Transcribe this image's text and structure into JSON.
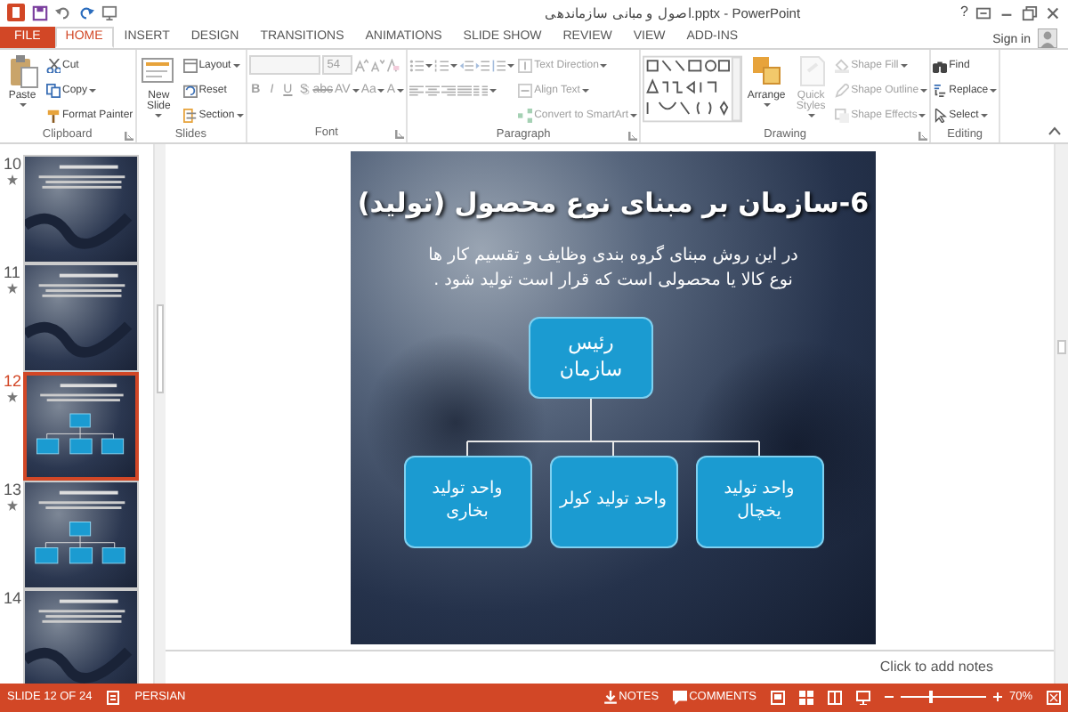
{
  "window": {
    "title": "اصول و مبانی سازماندهی.pptx - PowerPoint",
    "help": "?"
  },
  "tabs": [
    {
      "label": "FILE",
      "kind": "file",
      "selected": false
    },
    {
      "label": "HOME",
      "kind": "tab",
      "selected": true
    },
    {
      "label": "INSERT",
      "kind": "tab",
      "selected": false
    },
    {
      "label": "DESIGN",
      "kind": "tab",
      "selected": false
    },
    {
      "label": "TRANSITIONS",
      "kind": "tab",
      "selected": false
    },
    {
      "label": "ANIMATIONS",
      "kind": "tab",
      "selected": false
    },
    {
      "label": "SLIDE SHOW",
      "kind": "tab",
      "selected": false
    },
    {
      "label": "REVIEW",
      "kind": "tab",
      "selected": false
    },
    {
      "label": "VIEW",
      "kind": "tab",
      "selected": false
    },
    {
      "label": "ADD-INS",
      "kind": "tab",
      "selected": false
    }
  ],
  "account": {
    "label": "Sign in"
  },
  "ribbon": {
    "groups": [
      {
        "label": "Clipboard",
        "launcher": true,
        "columns": [
          [
            [
              {
                "kind": "large",
                "label": "Paste",
                "caret": true,
                "disabled": false
              }
            ]
          ],
          [
            [
              {
                "kind": "small",
                "label": "Cut",
                "caret": false,
                "disabled": false
              }
            ],
            [
              {
                "kind": "small",
                "label": "Copy",
                "caret": true,
                "disabled": false
              }
            ],
            [
              {
                "kind": "small",
                "label": "Format Painter",
                "caret": false,
                "disabled": false
              }
            ]
          ]
        ]
      },
      {
        "label": "Slides",
        "launcher": false,
        "columns": [
          [
            [
              {
                "kind": "large",
                "label": "New Slide",
                "caret": true,
                "disabled": false
              }
            ]
          ],
          [
            [
              {
                "kind": "small",
                "label": "Layout",
                "caret": true,
                "disabled": false
              }
            ],
            [
              {
                "kind": "small",
                "label": "Reset",
                "caret": false,
                "disabled": false
              }
            ],
            [
              {
                "kind": "small",
                "label": "Section",
                "caret": true,
                "disabled": false
              }
            ]
          ]
        ]
      },
      {
        "label": "Font",
        "launcher": true,
        "columns": [
          [
            [
              {
                "kind": "fontname",
                "disabled": true
              },
              {
                "kind": "fontsize",
                "value": "54",
                "disabled": true
              },
              {
                "kind": "icon",
                "caret": false,
                "disabled": true
              },
              {
                "kind": "icon",
                "caret": false,
                "disabled": true
              },
              {
                "kind": "icon",
                "caret": false,
                "disabled": true
              }
            ],
            [
              {
                "kind": "bold",
                "label": "B",
                "caret": false,
                "disabled": true
              },
              {
                "kind": "italic",
                "label": "I",
                "caret": false,
                "disabled": true
              },
              {
                "kind": "underline",
                "label": "U",
                "caret": false,
                "disabled": true
              },
              {
                "kind": "shadow",
                "label": "S",
                "caret": false,
                "disabled": true
              },
              {
                "kind": "strike",
                "label": "abc",
                "caret": false,
                "disabled": true
              },
              {
                "kind": "format",
                "label": "AV",
                "caret": true,
                "disabled": true
              },
              {
                "kind": "format",
                "label": "Aa",
                "caret": true,
                "disabled": true
              },
              {
                "kind": "format",
                "label": "A",
                "caret": true,
                "disabled": true
              }
            ]
          ]
        ]
      },
      {
        "label": "Paragraph",
        "launcher": true,
        "columns": [
          [
            [
              {
                "kind": "icon",
                "caret": true,
                "disabled": true
              },
              {
                "kind": "icon",
                "caret": true,
                "disabled": true
              },
              {
                "kind": "icon",
                "caret": false,
                "disabled": true
              },
              {
                "kind": "icon",
                "caret": false,
                "disabled": true
              },
              {
                "kind": "icon",
                "caret": true,
                "disabled": true
              }
            ],
            [
              {
                "kind": "icon",
                "caret": false,
                "disabled": true
              },
              {
                "kind": "icon",
                "caret": false,
                "disabled": true
              },
              {
                "kind": "icon",
                "caret": false,
                "disabled": true
              },
              {
                "kind": "icon",
                "caret": false,
                "disabled": true
              },
              {
                "kind": "icon",
                "caret": true,
                "disabled": true
              }
            ]
          ],
          [
            [
              {
                "kind": "small",
                "label": "Text Direction",
                "caret": true,
                "disabled": true
              }
            ],
            [
              {
                "kind": "small",
                "label": "Align Text",
                "caret": true,
                "disabled": true
              }
            ],
            [
              {
                "kind": "small",
                "label": "Convert to SmartArt",
                "caret": true,
                "disabled": true
              }
            ]
          ]
        ]
      },
      {
        "label": "Drawing",
        "launcher": true,
        "columns": [
          [
            [
              {
                "kind": "gallery",
                "disabled": false
              }
            ]
          ],
          [
            [
              {
                "kind": "large",
                "label": "Arrange",
                "caret": true,
                "disabled": false
              }
            ]
          ],
          [
            [
              {
                "kind": "large",
                "label": "Quick Styles",
                "caret": true,
                "disabled": true
              }
            ]
          ],
          [
            [
              {
                "kind": "small",
                "label": "Shape Fill",
                "caret": true,
                "disabled": true
              }
            ],
            [
              {
                "kind": "small",
                "label": "Shape Outline",
                "caret": true,
                "disabled": true
              }
            ],
            [
              {
                "kind": "small",
                "label": "Shape Effects",
                "caret": true,
                "disabled": true
              }
            ]
          ]
        ]
      },
      {
        "label": "Editing",
        "launcher": false,
        "columns": [
          [
            [
              {
                "kind": "small",
                "label": "Find",
                "caret": false,
                "disabled": false
              }
            ],
            [
              {
                "kind": "small",
                "label": "Replace",
                "caret": true,
                "disabled": false
              }
            ],
            [
              {
                "kind": "small",
                "label": "Select",
                "caret": true,
                "disabled": false
              }
            ]
          ]
        ]
      }
    ]
  },
  "thumbnails": [
    {
      "number": "10",
      "animated": true,
      "kind": "text",
      "selected": false
    },
    {
      "number": "11",
      "animated": true,
      "kind": "text",
      "selected": false
    },
    {
      "number": "12",
      "animated": true,
      "kind": "chart",
      "selected": true
    },
    {
      "number": "13",
      "animated": true,
      "kind": "chart",
      "selected": false
    },
    {
      "number": "14",
      "animated": false,
      "kind": "text",
      "selected": false
    }
  ],
  "slide": {
    "title": "6-سازمان بر مبنای نوع محصول (تولید)",
    "body": "در این روش مبنای گروه بندی وظایف و تقسیم کار ها نوع کالا یا محصولی است که قرار است تولید شود .",
    "org_chart": {
      "label": "رئیس سازمان",
      "children": [
        {
          "label": "واحد تولید یخچال"
        },
        {
          "label": "واحد تولید کولر"
        },
        {
          "label": "واحد تولید بخاری"
        }
      ]
    }
  },
  "notes": {
    "placeholder": "Click to add notes"
  },
  "status_bar": {
    "slide": "SLIDE 12 OF 24",
    "language": "PERSIAN",
    "notes": "NOTES",
    "comments": "COMMENTS",
    "zoom": {
      "level": 0.35,
      "reading": "70%"
    }
  }
}
